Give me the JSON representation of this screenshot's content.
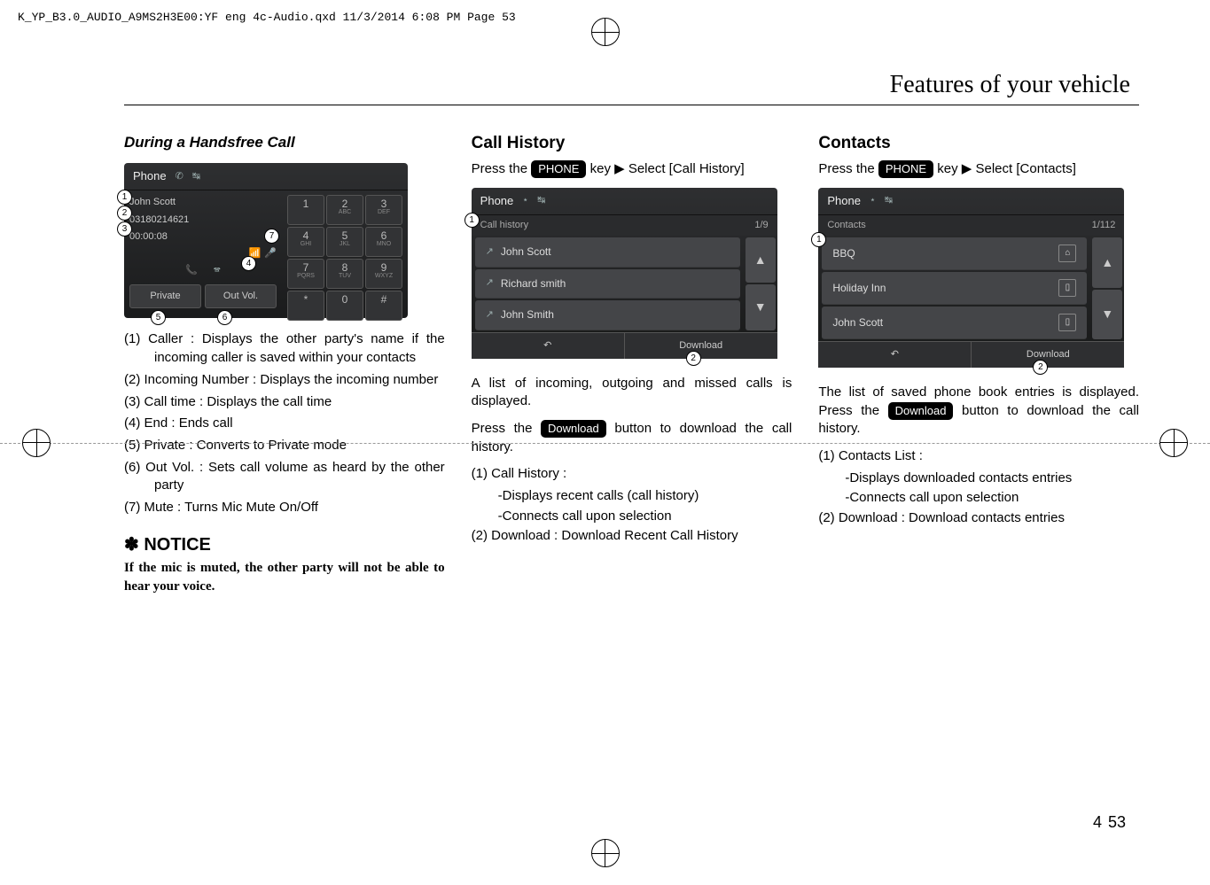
{
  "headerLine": "K_YP_B3.0_AUDIO_A9MS2H3E00:YF eng 4c-Audio.qxd  11/3/2014  6:08 PM  Page 53",
  "sectionTitle": "Features of your vehicle",
  "col1": {
    "heading": "During a Handsfree Call",
    "shot": {
      "topLabel": "Phone",
      "name": "John Scott",
      "number": "03180214621",
      "time": "00:00:08",
      "btnPrivate": "Private",
      "btnOutVol": "Out Vol.",
      "keys": [
        "1",
        "2",
        "3",
        "4",
        "5",
        "6",
        "7",
        "8",
        "9",
        "*",
        "0",
        "#"
      ],
      "keysubs": [
        "",
        "ABC",
        "DEF",
        "GHI",
        "JKL",
        "MNO",
        "PQRS",
        "TUV",
        "WXYZ",
        "",
        "",
        ""
      ]
    },
    "items": [
      "(1) Caller : Displays the other party's name if the incoming caller is saved within your contacts",
      "(2) Incoming Number : Displays the incoming number",
      "(3) Call time : Displays the call time",
      "(4) End : Ends call",
      "(5) Private : Converts to Private mode",
      "(6) Out Vol. : Sets call volume as heard by the other party",
      "(7) Mute : Turns Mic Mute On/Off"
    ],
    "noticeHead": "✽ NOTICE",
    "noticeBody": "If the mic is muted, the other party will not be able to hear your voice."
  },
  "col2": {
    "heading": "Call History",
    "intro1a": "Press the ",
    "keyLabel": "PHONE",
    "intro1b": " key ▶ Select [Call History]",
    "shot": {
      "topLabel": "Phone",
      "subhead": "Call history",
      "count": "1/9",
      "rows": [
        "John Scott",
        "Richard smith",
        "John Smith"
      ],
      "download": "Download"
    },
    "para1": "A list of incoming, outgoing and missed calls is displayed.",
    "para2a": "Press the ",
    "btnDownload": "Download",
    "para2b": " button to download the call history.",
    "listHead": "(1) Call History :",
    "listSub1": "-Displays recent calls (call history)",
    "listSub2": "-Connects call upon selection",
    "list2": "(2) Download : Download Recent Call History"
  },
  "col3": {
    "heading": "Contacts",
    "intro1a": "Press the ",
    "keyLabel": "PHONE",
    "intro1b": " key ▶ Select [Contacts]",
    "shot": {
      "topLabel": "Phone",
      "subhead": "Contacts",
      "count": "1/112",
      "rows": [
        "BBQ",
        "Holiday Inn",
        "John Scott"
      ],
      "download": "Download"
    },
    "para1a": "The list of saved phone book entries is displayed. Press the ",
    "btnDownload": "Download",
    "para1b": " button to download the call history.",
    "listHead": "(1) Contacts List :",
    "listSub1": "-Displays downloaded contacts entries",
    "listSub2": "-Connects call upon selection",
    "list2": "(2) Download : Download contacts entries"
  },
  "footer": {
    "chapter": "4",
    "page": "53"
  }
}
